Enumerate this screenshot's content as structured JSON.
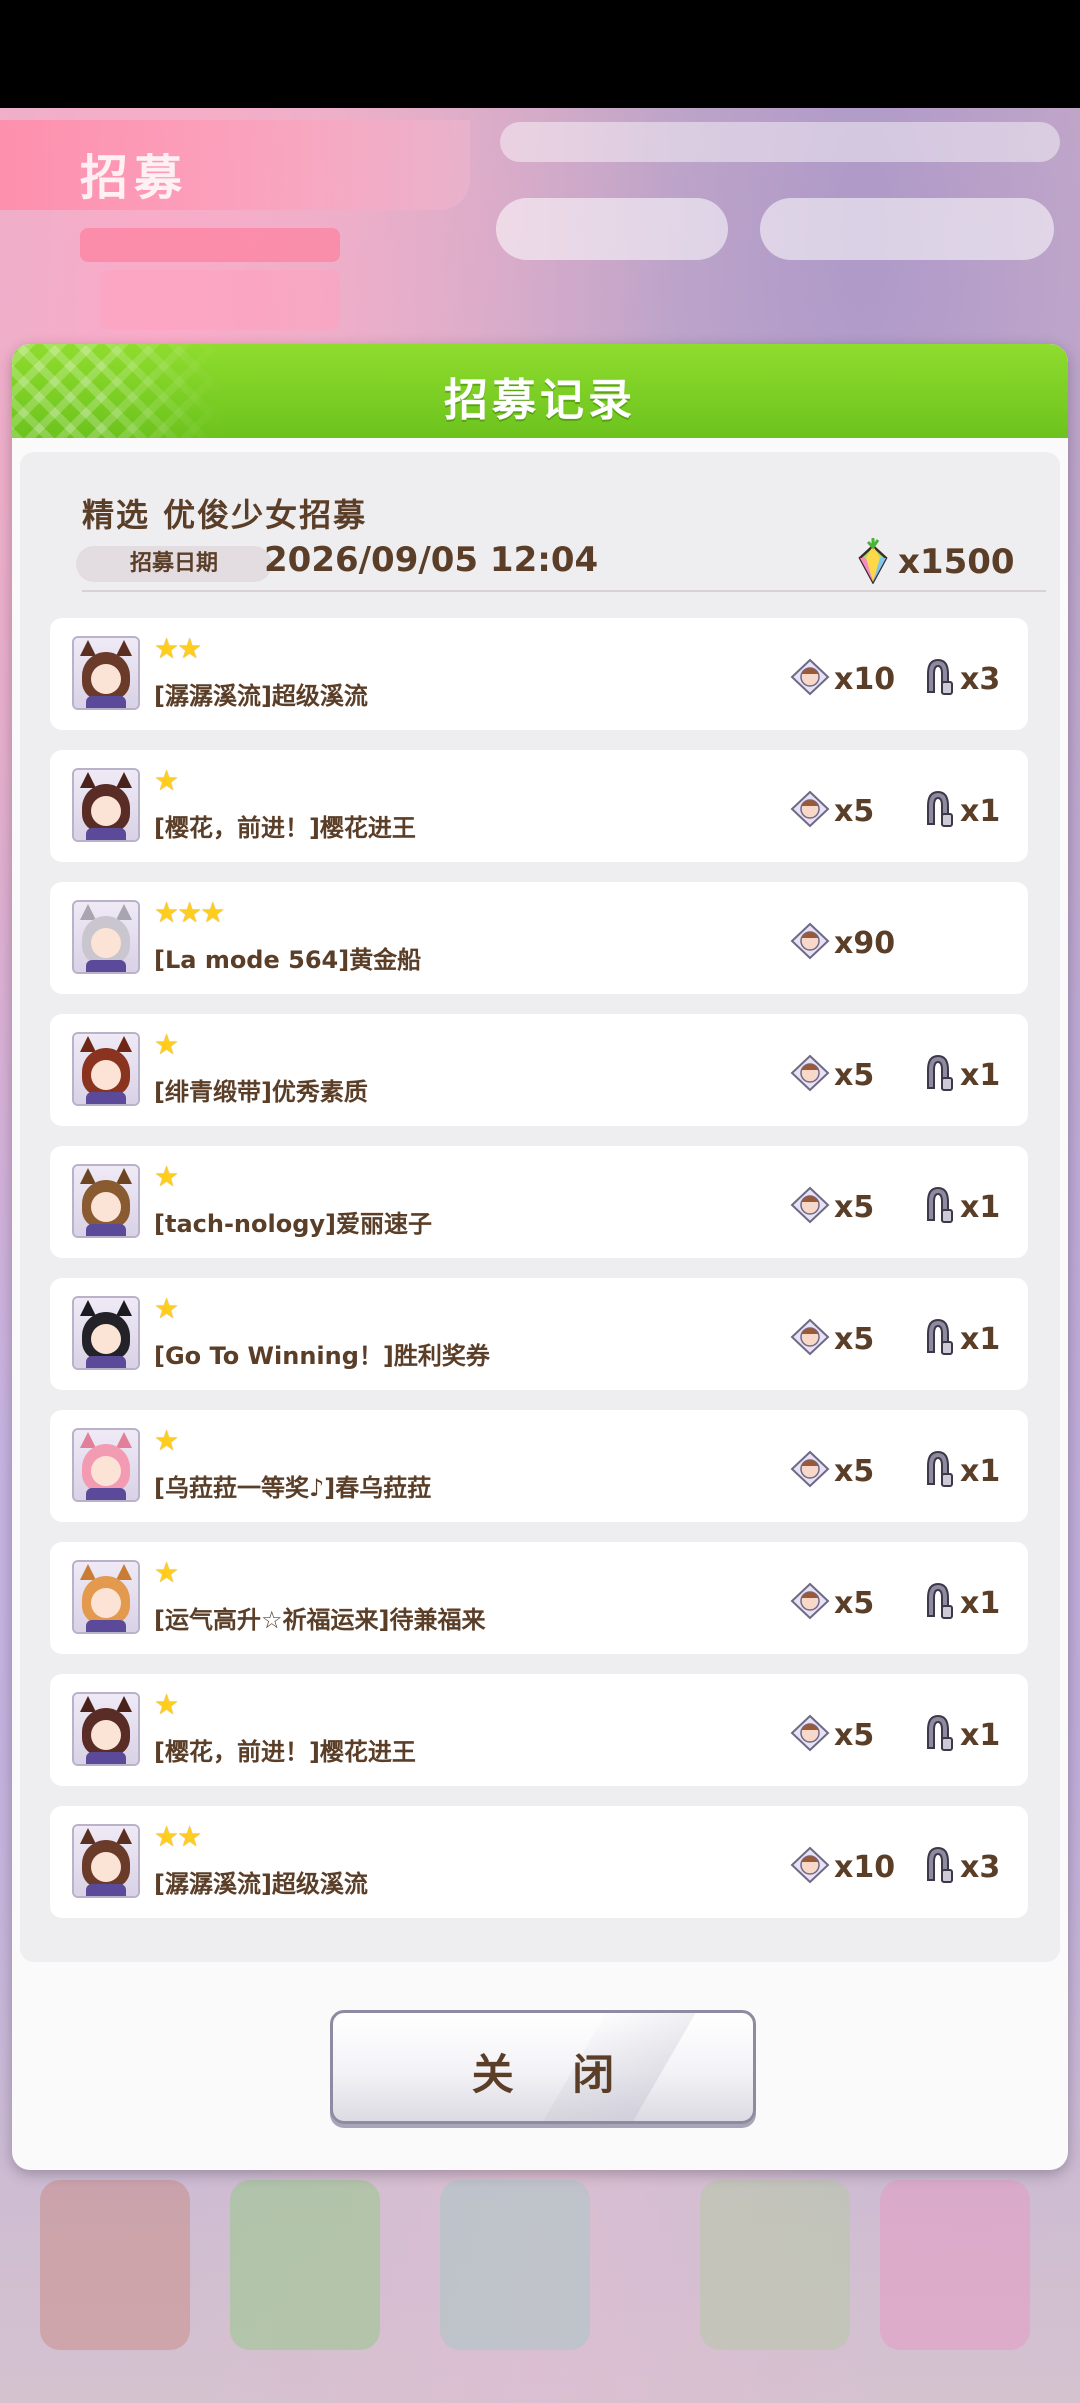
{
  "dialog": {
    "title": "招募记录",
    "banner_name": "精选 优俊少女招募",
    "date_label": "招募日期",
    "date_value": "2026/09/05 12:04",
    "cost_icon": "carrot-jewel-icon",
    "cost_value": "x1500",
    "close_label": "关 闭"
  },
  "records": [
    {
      "stars": "★★",
      "name": "[潺潺溪流]超级溪流",
      "shard_icon": "character-piece-icon",
      "shard_count": "x10",
      "memento_icon": "horseshoe-memento-icon",
      "memento_count": "x3",
      "hair": "#6b3b2a",
      "ear": "#5a2f22"
    },
    {
      "stars": "★",
      "name": "[樱花，前进！]樱花进王",
      "shard_icon": "character-piece-icon",
      "shard_count": "x5",
      "memento_icon": "horseshoe-memento-icon",
      "memento_count": "x1",
      "hair": "#5a2c26",
      "ear": "#4a221c"
    },
    {
      "stars": "★★★",
      "name": "[La mode 564]黄金船",
      "shard_icon": "character-piece-icon",
      "shard_count": "x90",
      "memento_icon": "",
      "memento_count": "",
      "hair": "#c9c6cf",
      "ear": "#a8a4b0"
    },
    {
      "stars": "★",
      "name": "[绯青缎带]优秀素质",
      "shard_icon": "character-piece-icon",
      "shard_count": "x5",
      "memento_icon": "horseshoe-memento-icon",
      "memento_count": "x1",
      "hair": "#8a3420",
      "ear": "#6e2716"
    },
    {
      "stars": "★",
      "name": "[tach-nology]爱丽速子",
      "shard_icon": "character-piece-icon",
      "shard_count": "x5",
      "memento_icon": "horseshoe-memento-icon",
      "memento_count": "x1",
      "hair": "#8a5a30",
      "ear": "#6d4422"
    },
    {
      "stars": "★",
      "name": "[Go To Winning！]胜利奖券",
      "shard_icon": "character-piece-icon",
      "shard_count": "x5",
      "memento_icon": "horseshoe-memento-icon",
      "memento_count": "x1",
      "hair": "#222228",
      "ear": "#1a1a20"
    },
    {
      "stars": "★",
      "name": "[乌菈菈一等奖♪]春乌菈菈",
      "shard_icon": "character-piece-icon",
      "shard_count": "x5",
      "memento_icon": "horseshoe-memento-icon",
      "memento_count": "x1",
      "hair": "#f29bb2",
      "ear": "#e27f99"
    },
    {
      "stars": "★",
      "name": "[运气高升☆祈福运来]待兼福来",
      "shard_icon": "character-piece-icon",
      "shard_count": "x5",
      "memento_icon": "horseshoe-memento-icon",
      "memento_count": "x1",
      "hair": "#e49a4e",
      "ear": "#c97c34"
    },
    {
      "stars": "★",
      "name": "[樱花，前进！]樱花进王",
      "shard_icon": "character-piece-icon",
      "shard_count": "x5",
      "memento_icon": "horseshoe-memento-icon",
      "memento_count": "x1",
      "hair": "#5a2c26",
      "ear": "#4a221c"
    },
    {
      "stars": "★★",
      "name": "[潺潺溪流]超级溪流",
      "shard_icon": "character-piece-icon",
      "shard_count": "x10",
      "memento_icon": "horseshoe-memento-icon",
      "memento_count": "x3",
      "hair": "#6b3b2a",
      "ear": "#5a2f22"
    }
  ],
  "background": {
    "banner_text": "招募"
  }
}
